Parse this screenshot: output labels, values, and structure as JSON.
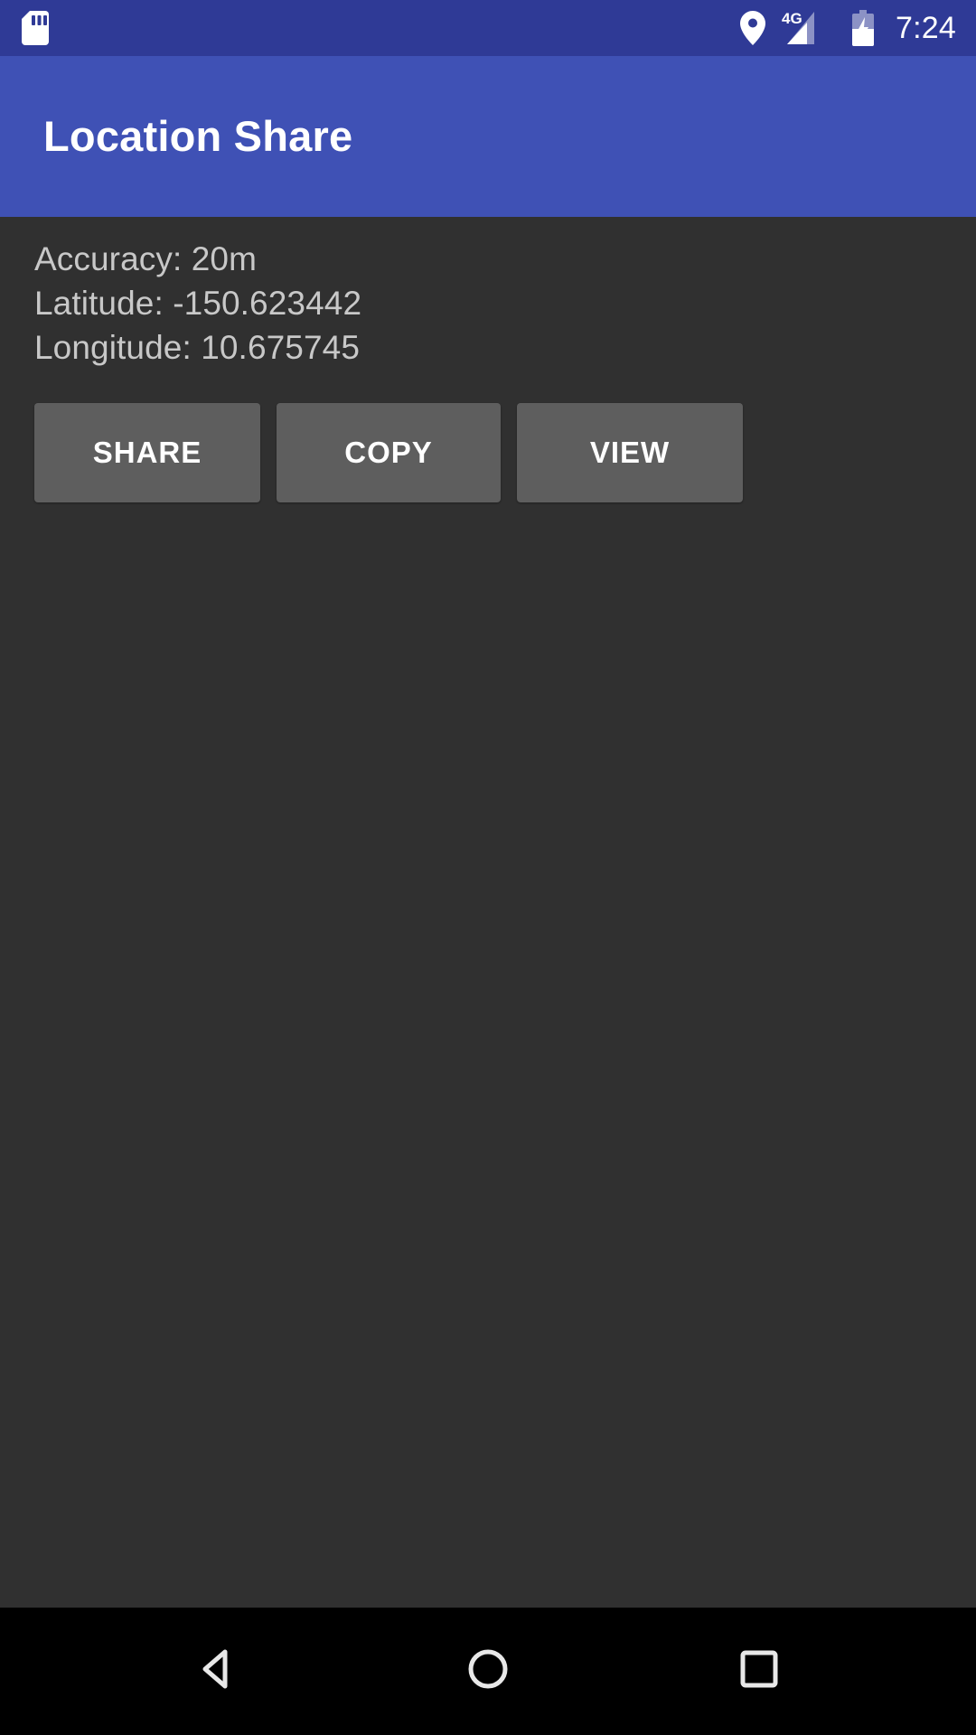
{
  "status_bar": {
    "background_color": "#2f3a96",
    "left_icons": [
      {
        "name": "sdcard-icon",
        "label": "SD card"
      }
    ],
    "right_icons": [
      {
        "name": "location-pin-icon",
        "label": "Location"
      },
      {
        "name": "signal-4g-icon",
        "label": "4G",
        "network_label": "4G"
      },
      {
        "name": "battery-charging-icon",
        "label": "Battery charging"
      }
    ],
    "network_label": "4G",
    "time": "7:24"
  },
  "app_bar": {
    "title": "Location Share",
    "background_color": "#3f51b5",
    "text_color": "#ffffff"
  },
  "content": {
    "background_color": "#303030",
    "text_color": "#c8c8c8",
    "info_lines": [
      "Accuracy: 20m",
      "Latitude: -150.623442",
      "Longitude: 10.675745"
    ],
    "location": {
      "accuracy_label": "Accuracy:",
      "accuracy_value": "20m",
      "latitude_label": "Latitude:",
      "latitude_value": "-150.623442",
      "longitude_label": "Longitude:",
      "longitude_value": "10.675745"
    },
    "buttons": [
      {
        "name": "share-button",
        "label": "SHARE"
      },
      {
        "name": "copy-button",
        "label": "COPY"
      },
      {
        "name": "view-button",
        "label": "VIEW"
      }
    ],
    "button_color": "#5e5e5e",
    "button_text_color": "#ffffff"
  },
  "nav_bar": {
    "background_color": "#000000",
    "keys": [
      {
        "name": "back-button",
        "label": "Back"
      },
      {
        "name": "home-button",
        "label": "Home"
      },
      {
        "name": "recents-button",
        "label": "Recents"
      }
    ]
  }
}
